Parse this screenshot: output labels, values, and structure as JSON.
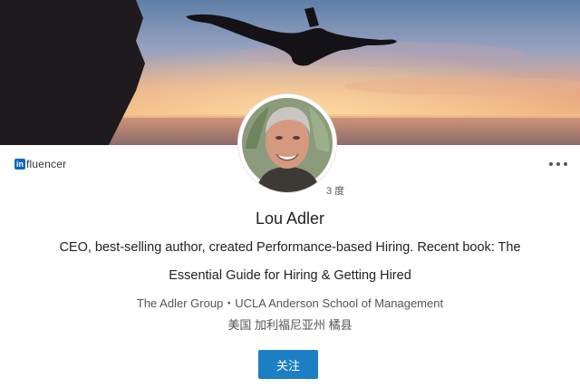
{
  "cover": {
    "image": "sunset-cliff-diver-photo"
  },
  "badge": {
    "logo_text": "in",
    "label": "fluencer"
  },
  "menu": {
    "icon": "more-horizontal-icon"
  },
  "profile": {
    "avatar": "profile-photo",
    "connection_degree": "3 度",
    "name": "Lou Adler",
    "headline": "CEO, best-selling author, created Performance-based Hiring. Recent book: The Essential Guide for Hiring & Getting Hired",
    "company_line": "The Adler Group・UCLA Anderson School of Management",
    "location": "美国 加利福尼亚州 橘县"
  },
  "actions": {
    "follow_label": "关注"
  },
  "colors": {
    "follow_button": "#1c7fc4",
    "linkedin_blue": "#0a66c2"
  }
}
